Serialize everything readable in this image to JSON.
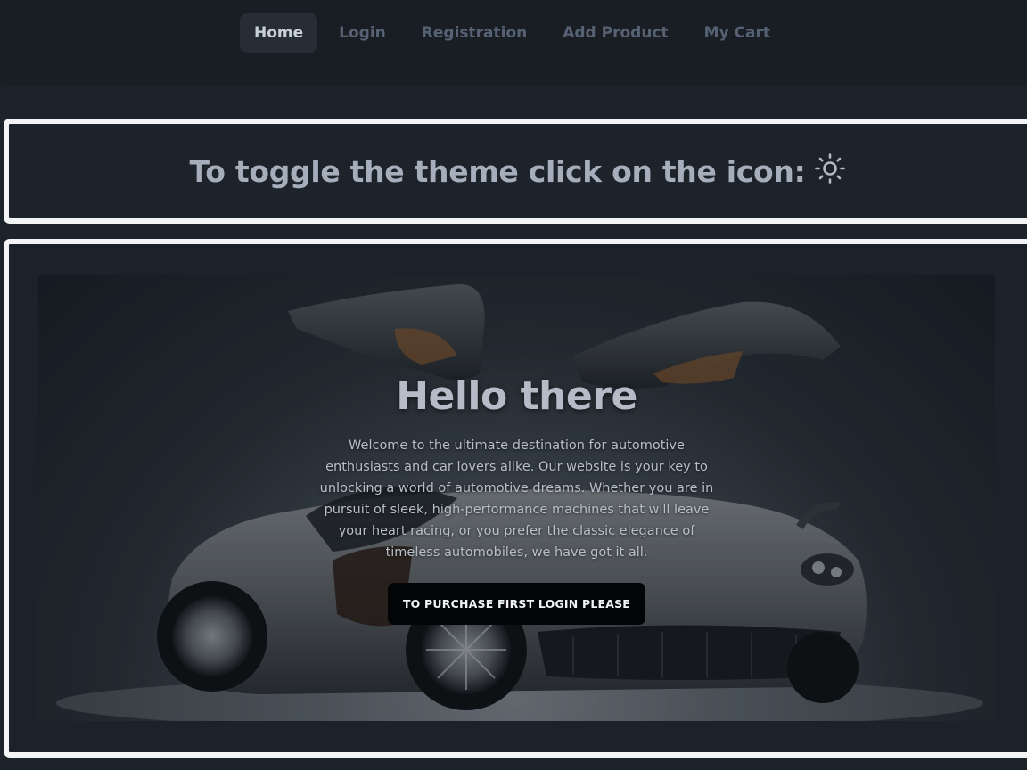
{
  "nav": {
    "items": [
      {
        "label": "Home",
        "active": true
      },
      {
        "label": "Login",
        "active": false
      },
      {
        "label": "Registration",
        "active": false
      },
      {
        "label": "Add Product",
        "active": false
      },
      {
        "label": "My Cart",
        "active": false
      }
    ]
  },
  "theme_card": {
    "text": "To toggle the theme click on the icon:",
    "icon": "sun-icon"
  },
  "hero": {
    "title": "Hello there",
    "description": "Welcome to the ultimate destination for automotive enthusiasts and car lovers alike. Our website is your key to unlocking a world of automotive dreams. Whether you are in pursuit of sleek, high-performance machines that will leave your heart racing, or you prefer the classic elegance of timeless automobiles, we have got it all.",
    "button_label": "TO PURCHASE FIRST LOGIN PLEASE",
    "image": "supercar-image"
  },
  "colors": {
    "background": "#1d232a",
    "navbar": "#191e24",
    "active_nav_bg": "#262d35",
    "card_border": "#f3f4f6",
    "text_muted": "#a6adbb",
    "button_bg": "#030405"
  }
}
